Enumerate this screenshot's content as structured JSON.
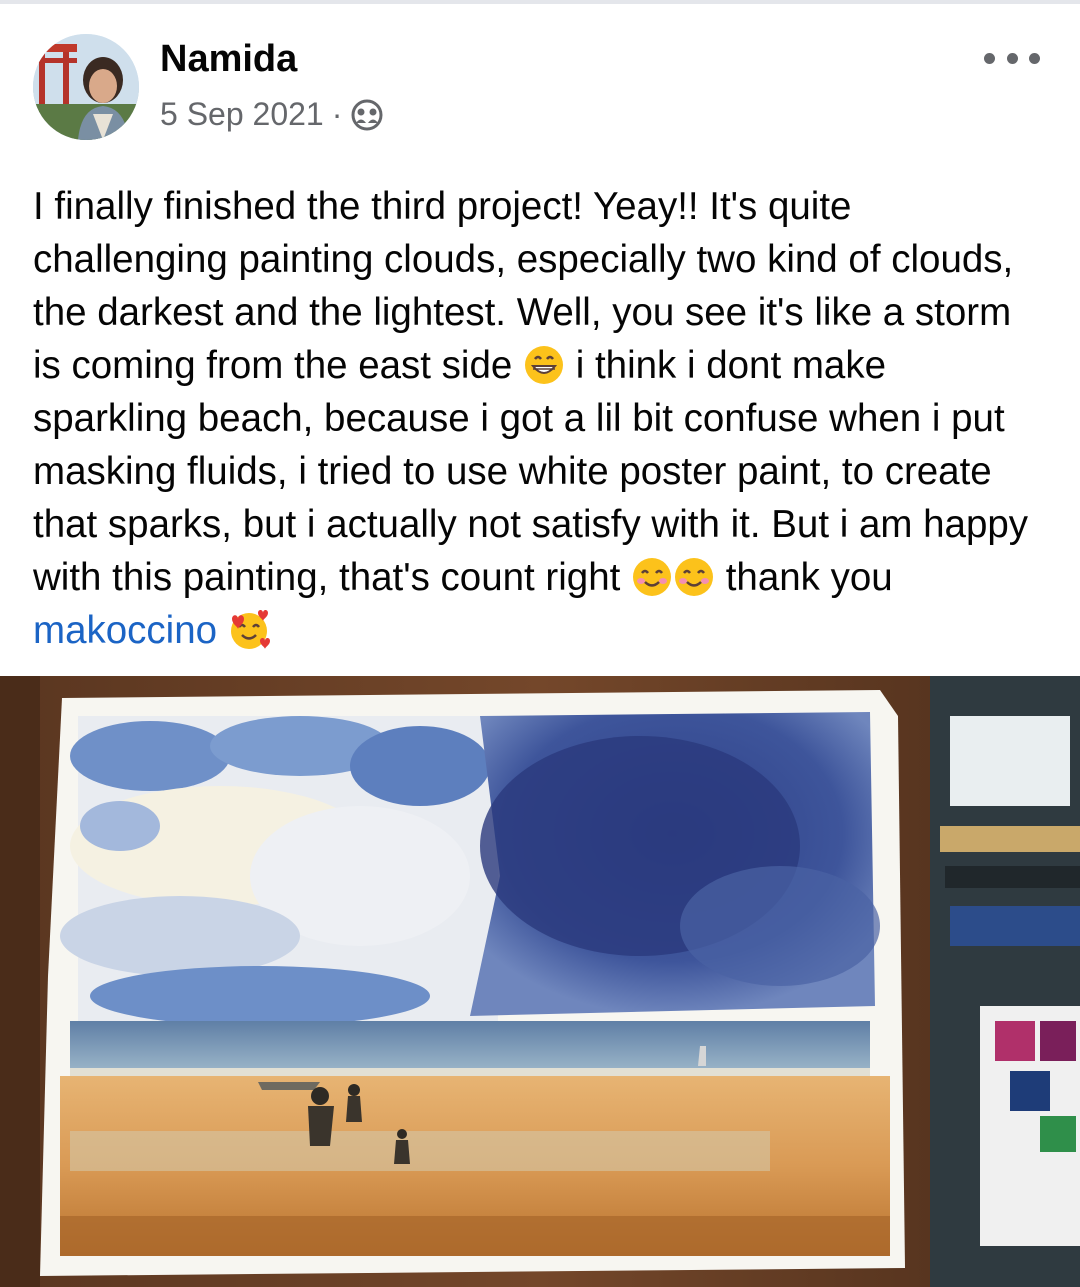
{
  "post": {
    "author": "Namida",
    "date": "5 Sep 2021",
    "separator": "·",
    "audience_icon": "friends-icon",
    "more_icon": "more-options-icon",
    "text": {
      "part1": "I finally finished the third project! Yeay!! It's quite challenging painting clouds, especially two kind of clouds, the darkest and the lightest. Well, you see it's like a storm is coming from the east side ",
      "part2": " i think i dont make sparkling beach, because i got a lil bit confuse when i put masking fluids, i tried to use white poster paint, to create that sparks, but i actually not satisfy with it. But i am happy with this painting, that's count right ",
      "part3": " thank you ",
      "mention": "makoccino",
      "emojis": [
        "grinning-face-with-smiling-eyes",
        "smiling-face-with-smiling-eyes",
        "smiling-face-with-smiling-eyes",
        "smiling-face-with-hearts"
      ]
    },
    "photo_subject": "watercolor-painting-beach-storm-clouds"
  },
  "colors": {
    "text": "#050505",
    "secondary": "#65676b",
    "mention": "#1b64c5"
  }
}
